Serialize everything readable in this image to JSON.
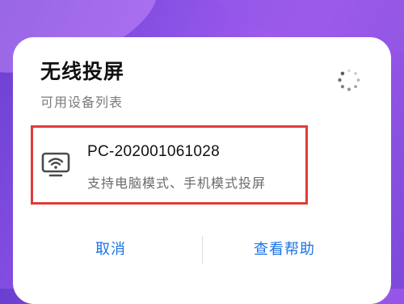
{
  "dialog": {
    "title": "无线投屏",
    "subtitle": "可用设备列表",
    "loading_icon": "spinner-icon"
  },
  "devices": [
    {
      "name": "PC-202001061028",
      "description": "支持电脑模式、手机模式投屏",
      "icon": "wireless-display-icon",
      "highlighted": true
    }
  ],
  "buttons": {
    "cancel_label": "取消",
    "help_label": "查看帮助"
  },
  "colors": {
    "accent": "#1a73e8",
    "highlight_border": "#e03b3b",
    "background_purple": "#8b52e6"
  }
}
